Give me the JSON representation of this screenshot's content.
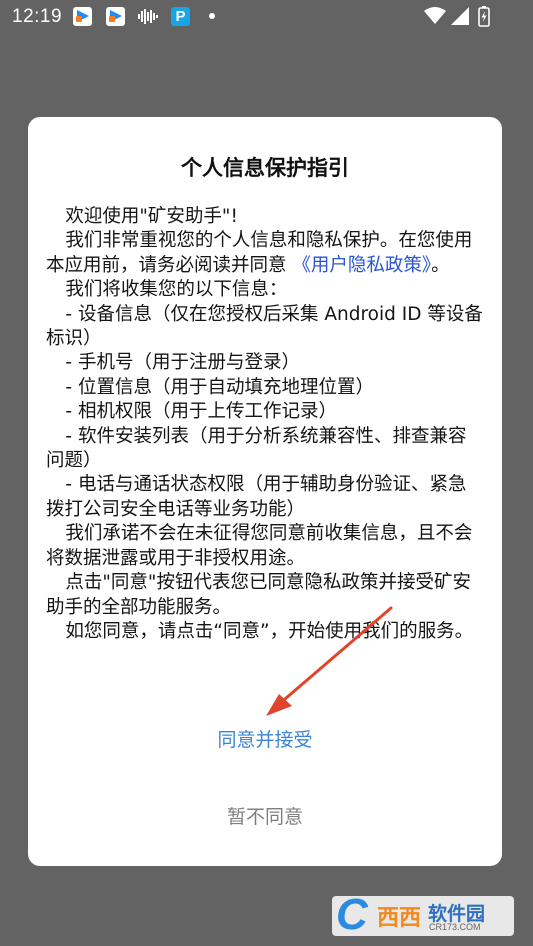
{
  "status_bar": {
    "time": "12:19"
  },
  "dialog": {
    "title": "个人信息保护指引",
    "paragraphs": {
      "welcome": "欢迎使用\"矿安助手\"!",
      "intro_before_link": "我们非常重视您的个人信息和隐私保护。在您使用本应用前，请务必阅读并同意",
      "policy_link": "《用户隐私政策》",
      "intro_after_link": "。",
      "collect_intro": "我们将收集您的以下信息：",
      "item_device": "- 设备信息（仅在您授权后采集 Android ID 等设备标识）",
      "item_phone": "- 手机号（用于注册与登录）",
      "item_location": "- 位置信息（用于自动填充地理位置）",
      "item_camera": "- 相机权限（用于上传工作记录）",
      "item_apps": "- 软件安装列表（用于分析系统兼容性、排查兼容问题）",
      "item_call": "- 电话与通话状态权限（用于辅助身份验证、紧急拨打公司安全电话等业务功能）",
      "promise": "我们承诺不会在未征得您同意前收集信息，且不会将数据泄露或用于非授权用途。",
      "click_hint": "点击\"同意\"按钮代表您已同意隐私政策并接受矿安助手的全部功能服务。",
      "final": "如您同意，请点击“同意”，开始使用我们的服务。"
    },
    "accept_label": "同意并接受",
    "reject_label": "暂不同意"
  },
  "watermark": {
    "brand": "西西",
    "name": "软件园",
    "url": "CR173.COM"
  },
  "colors": {
    "overlay": "#636363",
    "dialog_bg": "#ffffff",
    "link": "#2a55d6",
    "accept": "#3c85d8",
    "reject": "#7f7f7f",
    "annotation_arrow": "#e0452c"
  },
  "icons": {
    "status": [
      "app-play-icon",
      "app-play-icon",
      "audio-waveform-icon",
      "p-app-icon",
      "notification-dot-icon",
      "wifi-icon",
      "cell-signal-icon",
      "battery-charging-icon"
    ],
    "annotation": "red-arrow-icon"
  }
}
